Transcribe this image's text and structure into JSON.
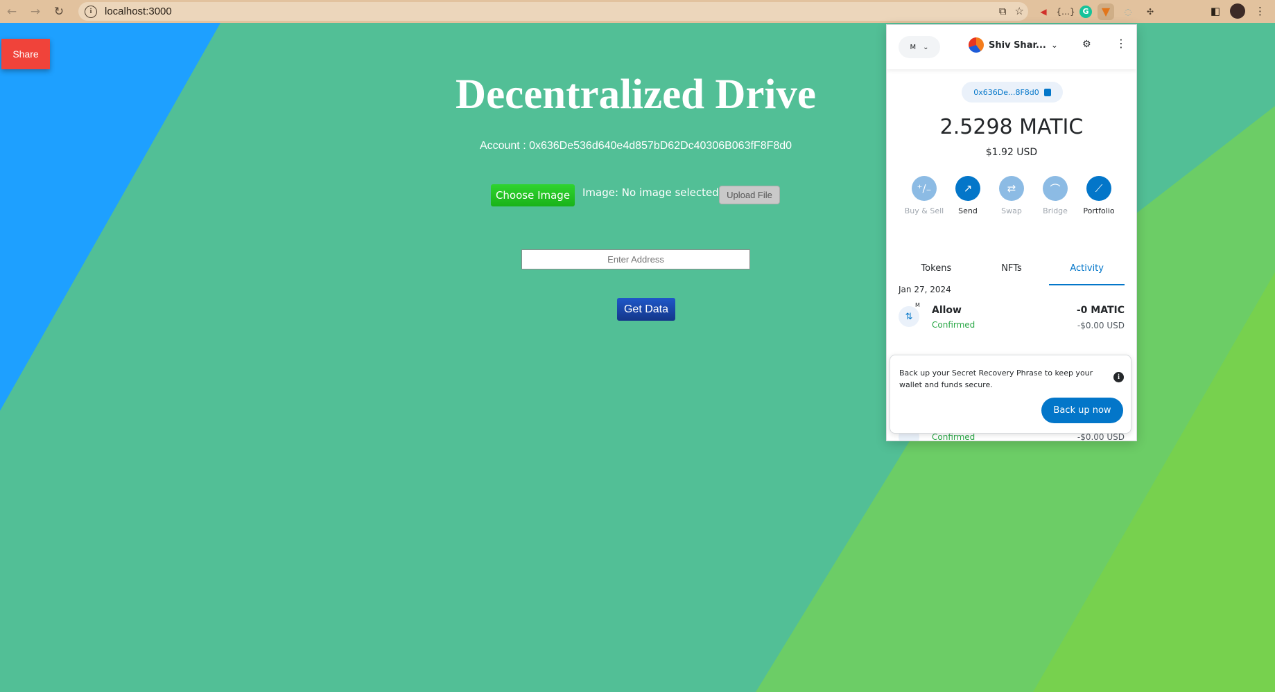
{
  "browser": {
    "url": "localhost:3000",
    "icons": {
      "back": "back-arrow-icon",
      "forward": "forward-arrow-icon",
      "reload": "reload-icon",
      "info": "site-info-icon",
      "install": "install-app-icon",
      "bookmark": "star-icon"
    },
    "extensions": [
      "announcement-extension-icon",
      "json-viewer-extension-icon",
      "grammarly-extension-icon",
      "metamask-extension-icon",
      "ghost-extension-icon",
      "puzzle-extensions-icon"
    ],
    "profile": "profile-avatar"
  },
  "page": {
    "share_label": "Share",
    "title": "Decentralized Drive",
    "account_text": "Account : 0x636De536d640e4d857bD62Dc40306B063fF8F8d0",
    "choose_image_label": "Choose Image",
    "image_status": "Image: No image selected",
    "upload_label": "Upload File",
    "address_placeholder": "Enter Address",
    "get_data_label": "Get Data",
    "colors": {
      "bg_green": "#52bf96",
      "bg_blue": "#1ea0ff",
      "bg_lime": "#6ccd66",
      "share": "#f0433a",
      "choose": "#22c322",
      "get_data": "#1a47a8"
    }
  },
  "metamask": {
    "network_initial": "M",
    "account_name": "Shiv Shar...",
    "address_short": "0x636De...8F8d0",
    "balance": "2.5298 MATIC",
    "fiat_balance": "$1.92 USD",
    "actions": [
      {
        "label": "Buy & Sell",
        "icon": "plus-minus-icon",
        "glyph": "⁺∕₋",
        "disabled": true
      },
      {
        "label": "Send",
        "icon": "send-arrow-icon",
        "glyph": "↗",
        "disabled": false
      },
      {
        "label": "Swap",
        "icon": "swap-arrows-icon",
        "glyph": "⇄",
        "disabled": true
      },
      {
        "label": "Bridge",
        "icon": "bridge-icon",
        "glyph": "⌒",
        "disabled": true
      },
      {
        "label": "Portfolio",
        "icon": "chart-icon",
        "glyph": "⟋",
        "disabled": false
      }
    ],
    "tabs": [
      "Tokens",
      "NFTs",
      "Activity"
    ],
    "active_tab": "Activity",
    "activity_date": "Jan 27, 2024",
    "transaction": {
      "title": "Allow",
      "status": "Confirmed",
      "amount": "-0 MATIC",
      "fiat": "-$0.00 USD",
      "badge": "M"
    },
    "next_transaction": {
      "status": "Confirmed",
      "fiat": "-$0.00 USD"
    },
    "backup_banner": {
      "text": "Back up your Secret Recovery Phrase to keep your wallet and funds secure.",
      "button": "Back up now"
    }
  }
}
